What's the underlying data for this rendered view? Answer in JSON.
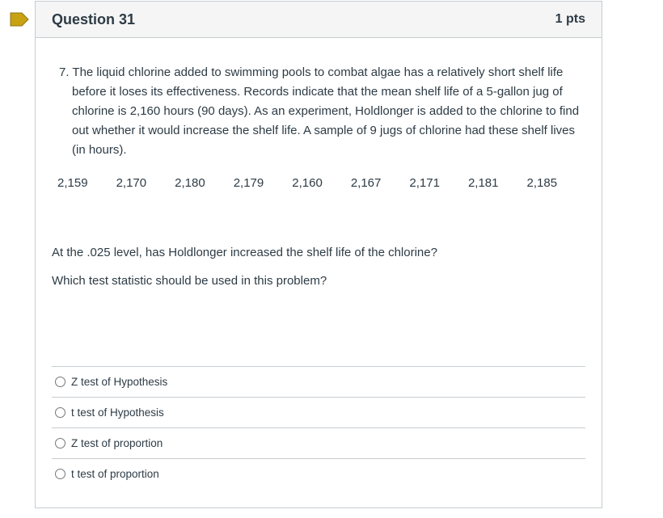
{
  "question": {
    "title": "Question 31",
    "points": "1 pts",
    "problem_text": "7. The liquid chlorine added to swimming pools to combat algae has a relatively short shelf life before it loses its effectiveness. Records indicate that the mean shelf life of a 5-gallon jug of chlorine is 2,160 hours (90 days). As an experiment, Holdlonger is added to the chlorine to find out whether it would increase the shelf life. A sample of 9 jugs of chlorine had these shelf lives (in hours).",
    "values": [
      "2,159",
      "2,170",
      "2,180",
      "2,179",
      "2,160",
      "2,167",
      "2,171",
      "2,181",
      "2,185"
    ],
    "prompt1": "At the .025 level, has Holdlonger increased the shelf life of the chlorine?",
    "prompt2": "Which test statistic should be used in this problem?",
    "answers": [
      "Z test of Hypothesis",
      "t test of Hypothesis",
      "Z test of proportion",
      "t test of proportion"
    ]
  },
  "colors": {
    "flag": "#c9a214",
    "border": "#c7cdd1",
    "header_bg": "#f5f5f5"
  },
  "icons": {
    "flag": "bookmark-flag-icon",
    "radio": "radio-button-icon"
  }
}
